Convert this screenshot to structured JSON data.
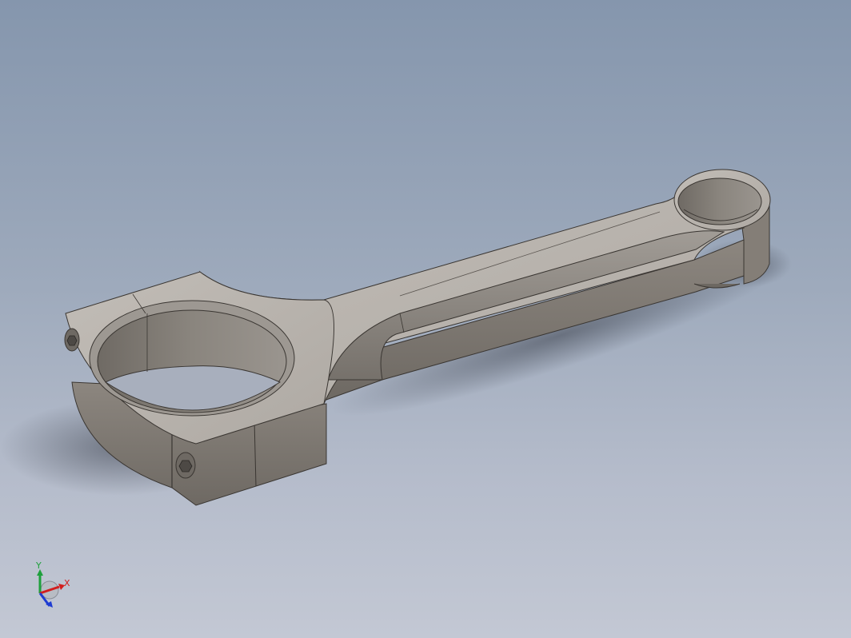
{
  "viewport": {
    "background_top": "#8596ad",
    "background_bottom": "#c3c8d4"
  },
  "model": {
    "part": "connecting-rod",
    "body_color": "#b9b4ae",
    "side_color": "#7d7770",
    "edge_color": "#3a3632"
  },
  "triad": {
    "x_label": "X",
    "y_label": "Y",
    "x_color": "#d21e1e",
    "y_color": "#1ea03c",
    "z_color": "#1e3cd2"
  }
}
